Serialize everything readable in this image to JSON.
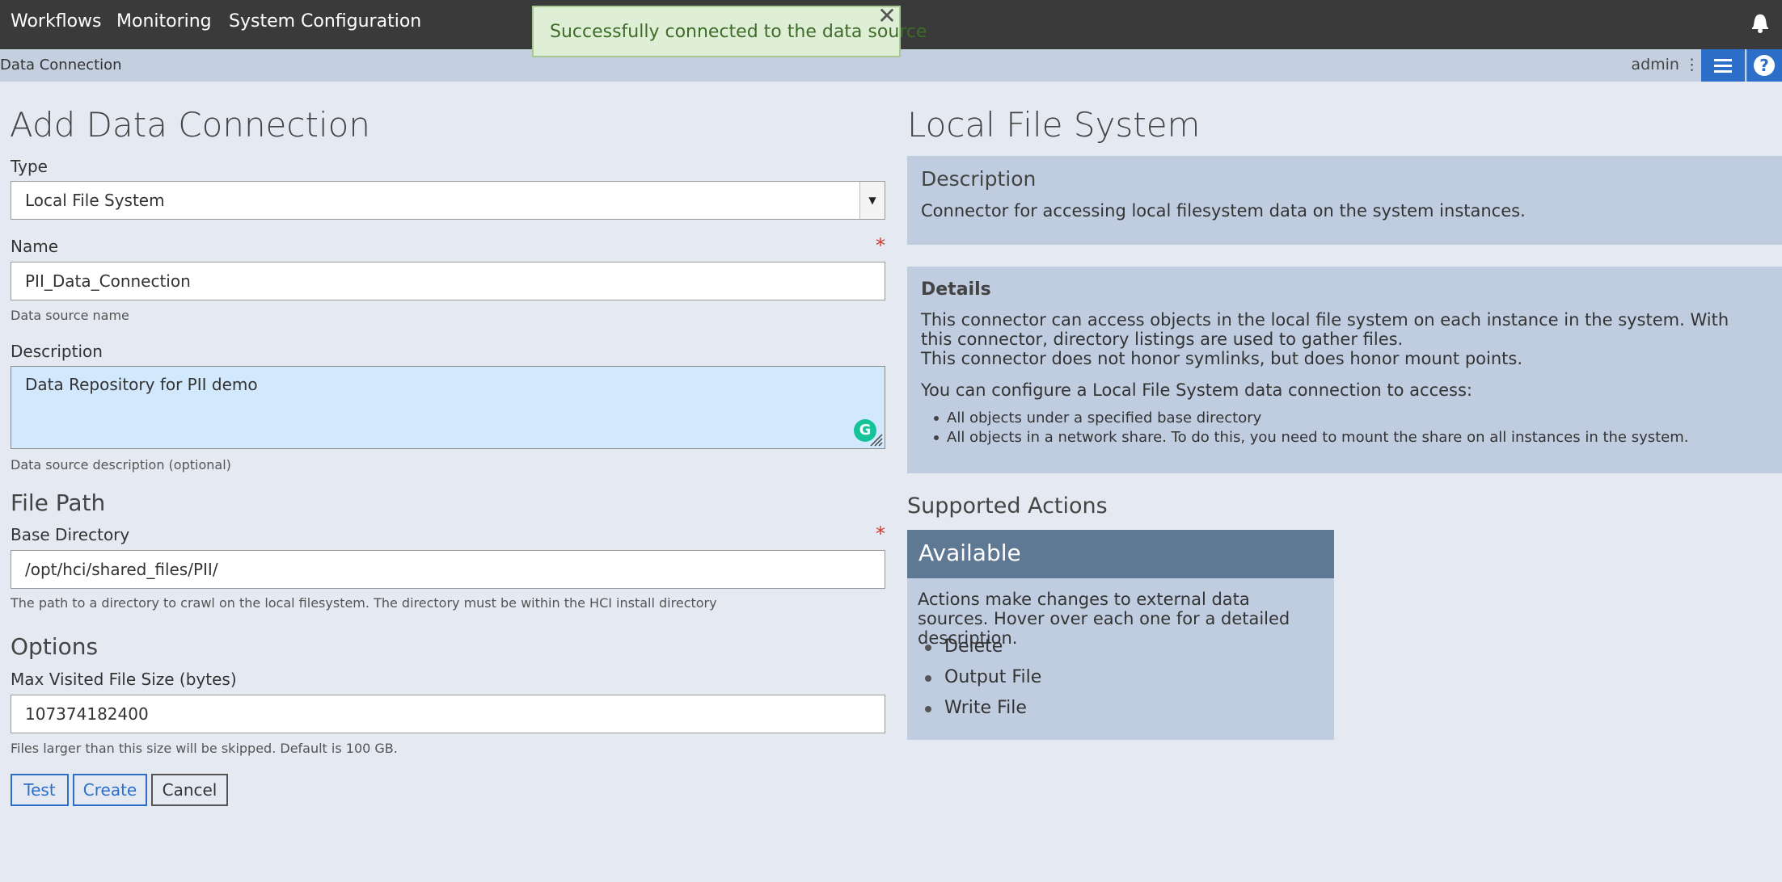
{
  "nav": {
    "items": [
      "Workflows",
      "Monitoring",
      "System Configuration"
    ]
  },
  "toast": {
    "message": "Successfully connected to the data source",
    "close": "✕"
  },
  "breadcrumb": {
    "current": "Data Connection",
    "user": "admin ⋮",
    "help": "?"
  },
  "form": {
    "title": "Add Data Connection",
    "type_label": "Type",
    "type_value": "Local File System",
    "name_label": "Name",
    "name_value": "PII_Data_Connection",
    "name_help": "Data source name",
    "required_mark": "*",
    "description_label": "Description",
    "description_value": "Data Repository for PII demo",
    "description_help": "Data source description (optional)",
    "file_path_heading": "File Path",
    "base_dir_label": "Base Directory",
    "base_dir_value": "/opt/hci/shared_files/PII/",
    "base_dir_help": "The path to a directory to crawl on the local filesystem. The directory must be within the HCI install directory",
    "options_heading": "Options",
    "max_size_label": "Max Visited File Size (bytes)",
    "max_size_value": "107374182400",
    "max_size_help": "Files larger than this size will be skipped. Default is 100 GB.",
    "buttons": {
      "test": "Test",
      "create": "Create",
      "cancel": "Cancel"
    }
  },
  "info": {
    "title": "Local File System",
    "description_heading": "Description",
    "description_text": "Connector for accessing local filesystem data on the system instances.",
    "details_heading": "Details",
    "details_text1": "This connector can access objects in the local file system on each instance in the system. With this connector, directory listings are used to gather files.",
    "details_text2": "This connector does not honor symlinks, but does honor mount points.",
    "details_text3": "You can configure a Local File System data connection to access:",
    "details_bullets": [
      "All objects under a specified base directory",
      "All objects in a network share. To do this, you need to mount the share on all instances in the system."
    ],
    "supported_heading": "Supported Actions",
    "available_heading": "Available",
    "actions_text": "Actions make changes to external data sources. Hover over each one for a detailed description.",
    "actions": [
      "Delete",
      "Output File",
      "Write File"
    ]
  },
  "colors": {
    "nav_bg": "#3a3a3a",
    "accent": "#2d6ec8",
    "toast_bg": "#dfefd6",
    "panel_bg": "#c0cde0",
    "required": "#d03a2a"
  }
}
